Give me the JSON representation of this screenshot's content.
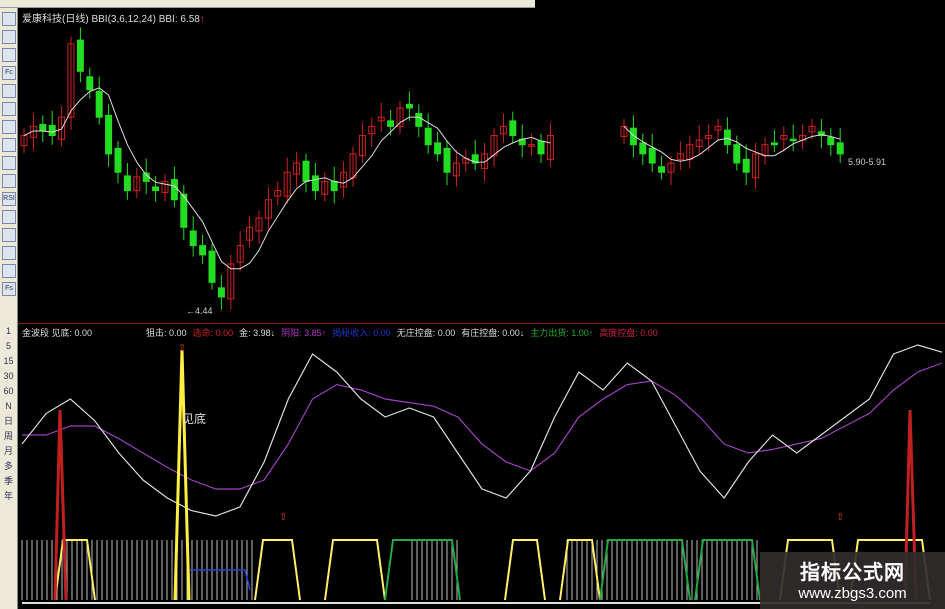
{
  "title": {
    "stock": "爱康科技(日线)",
    "indicator": "BBI(3,6,12,24)",
    "bbi_label": "BBI: 6.58"
  },
  "left_toolbar": [
    "trend-icon",
    "bars-icon",
    "window-icon",
    "fc-icon",
    "note-icon",
    "circle-icon",
    "fcl-icon",
    "fx-icon",
    "search-icon",
    "ruler-icon",
    "rsi-icon",
    "dollar-icon",
    "move-icon",
    "export-icon",
    "pencil-icon",
    "fs-icon"
  ],
  "left_toolbar_labels": {
    "rsi": "RSI",
    "fc": "Fc",
    "fs": "Fs"
  },
  "periods": [
    "1",
    "5",
    "15",
    "30",
    "60",
    "N",
    "日",
    "周",
    "月",
    "多",
    "季",
    "年"
  ],
  "indicator_bar": [
    {
      "label": "金波段 见底: 0.00",
      "color": "#dddddd"
    },
    {
      "label": "狙击: 0.00",
      "color": "#dddddd"
    },
    {
      "label": "逃命: 0.00",
      "color": "#cc2222"
    },
    {
      "label": "金: 3.98↓",
      "color": "#dddddd"
    },
    {
      "label": "阴阳: 3.85↑",
      "color": "#bb33cc"
    },
    {
      "label": "揭秘收入: 0.00",
      "color": "#2233cc"
    },
    {
      "label": "无庄控盘: 0.00",
      "color": "#dddddd"
    },
    {
      "label": "有庄控盘: 0.00↓",
      "color": "#dddddd"
    },
    {
      "label": "主力出货: 1.00↑",
      "color": "#22aa22"
    },
    {
      "label": "高度控盘: 0.00",
      "color": "#cc2244"
    }
  ],
  "price_labels": {
    "low": "←4.44",
    "right": "5.90-5.91"
  },
  "jiandi_label": "见底",
  "watermark": {
    "name": "指标公式网",
    "url": "www.zbgs3.com"
  },
  "colors": {
    "up": "#d32020",
    "down": "#22dd22",
    "bbi": "#dddddd",
    "osc_white": "#dddddd",
    "osc_purple": "#a040c0"
  },
  "candles_close": [
    6.2,
    6.3,
    6.25,
    6.2,
    6.4,
    7.2,
    6.9,
    6.7,
    6.4,
    6.0,
    5.8,
    5.6,
    5.75,
    5.7,
    5.6,
    5.7,
    5.5,
    5.2,
    5.0,
    4.9,
    4.6,
    4.44,
    4.8,
    5.0,
    5.2,
    5.3,
    5.5,
    5.6,
    5.8,
    5.9,
    5.7,
    5.6,
    5.7,
    5.6,
    5.8,
    6.0,
    6.2,
    6.3,
    6.4,
    6.3,
    6.5,
    6.5,
    6.3,
    6.1,
    6.0,
    5.8,
    5.9,
    5.95,
    5.9,
    6.0,
    6.2,
    6.3,
    6.2,
    6.1,
    6.1,
    6.0,
    6.2
  ],
  "candles_close_2": [
    6.3,
    6.1,
    6.0,
    5.9,
    5.8,
    5.9,
    6.0,
    6.1,
    6.15,
    6.2,
    6.3,
    6.1,
    5.9,
    5.8,
    6.0,
    6.1,
    6.1,
    6.2,
    6.15,
    6.2,
    6.3,
    6.2,
    6.1,
    6.0
  ],
  "osc_white": [
    45,
    62,
    70,
    58,
    40,
    25,
    15,
    8,
    5,
    10,
    35,
    70,
    95,
    85,
    70,
    60,
    65,
    60,
    40,
    20,
    15,
    30,
    60,
    85,
    75,
    90,
    80,
    55,
    30,
    15,
    35,
    50,
    40,
    50,
    60,
    70,
    95,
    100,
    96
  ],
  "osc_purple": [
    50,
    50,
    55,
    55,
    48,
    40,
    32,
    25,
    20,
    20,
    25,
    45,
    70,
    78,
    75,
    70,
    68,
    66,
    60,
    45,
    35,
    30,
    40,
    60,
    70,
    78,
    80,
    72,
    60,
    45,
    40,
    42,
    45,
    48,
    55,
    62,
    75,
    85,
    90
  ],
  "signals": {
    "jiandi_spike_index": 22,
    "red_spikes": [
      3,
      100
    ]
  }
}
